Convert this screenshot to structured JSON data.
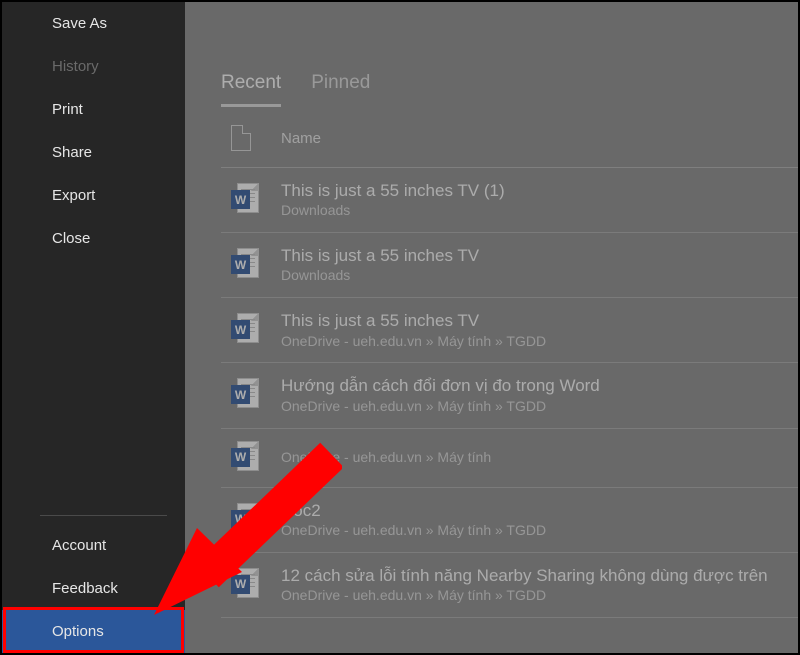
{
  "sidebar": {
    "top_items": [
      {
        "label": "Save As",
        "disabled": false
      },
      {
        "label": "History",
        "disabled": true
      },
      {
        "label": "Print",
        "disabled": false
      },
      {
        "label": "Share",
        "disabled": false
      },
      {
        "label": "Export",
        "disabled": false
      },
      {
        "label": "Close",
        "disabled": false
      }
    ],
    "bottom_items": [
      {
        "label": "Account",
        "selected": false
      },
      {
        "label": "Feedback",
        "selected": false
      },
      {
        "label": "Options",
        "selected": true
      }
    ]
  },
  "tabs": [
    {
      "label": "Recent",
      "active": true
    },
    {
      "label": "Pinned",
      "active": false
    }
  ],
  "header": {
    "name_label": "Name"
  },
  "documents": [
    {
      "title": "This is just a 55 inches TV (1)",
      "path": "Downloads"
    },
    {
      "title": "This is just a 55 inches TV",
      "path": "Downloads"
    },
    {
      "title": "This is just a 55 inches TV",
      "path": "OneDrive - ueh.edu.vn » Máy tính » TGDD"
    },
    {
      "title": "Hướng dẫn cách đổi đơn vị đo trong Word",
      "path": "OneDrive - ueh.edu.vn » Máy tính » TGDD"
    },
    {
      "title": "",
      "path": "OneDrive - ueh.edu.vn » Máy tính"
    },
    {
      "title": "Doc2",
      "path": "OneDrive - ueh.edu.vn » Máy tính » TGDD"
    },
    {
      "title": "12 cách sửa lỗi tính năng Nearby Sharing không dùng được trên",
      "path": "OneDrive - ueh.edu.vn » Máy tính » TGDD"
    }
  ],
  "annotation": {
    "arrow_color": "#ff0000"
  }
}
